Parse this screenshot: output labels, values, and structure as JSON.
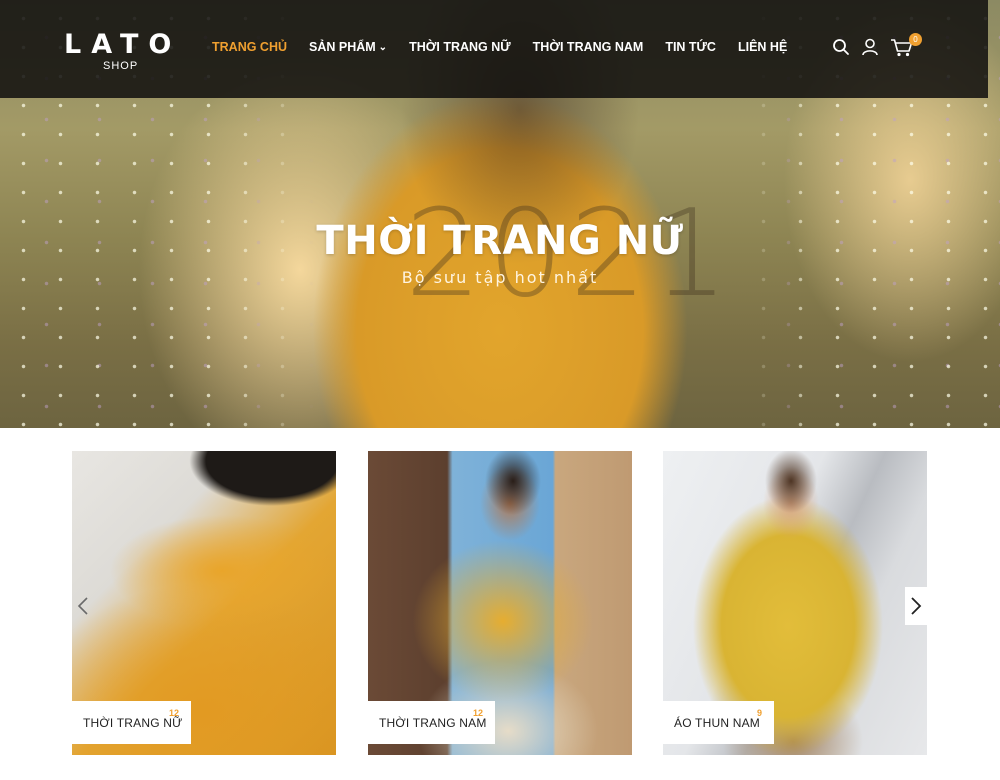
{
  "header": {
    "logo": {
      "main": "LATO",
      "sub": "SHOP"
    },
    "nav": [
      {
        "label": "TRANG CHỦ",
        "active": true
      },
      {
        "label": "SẢN PHẨM",
        "has_dropdown": true
      },
      {
        "label": "THỜI TRANG NỮ"
      },
      {
        "label": "THỜI TRANG NAM"
      },
      {
        "label": "TIN TỨC"
      },
      {
        "label": "LIÊN HỆ"
      }
    ],
    "icons": [
      "search-icon",
      "user-icon",
      "cart-icon"
    ],
    "cart_count": "0"
  },
  "hero": {
    "bg_text": "2021",
    "title": "THỜI TRANG NỮ",
    "subtitle": "Bộ sưu tập hot nhất"
  },
  "categories": [
    {
      "label": "THỜI TRANG NỮ",
      "count": "12"
    },
    {
      "label": "THỜI TRANG NAM",
      "count": "12"
    },
    {
      "label": "ÁO THUN NAM",
      "count": "9"
    }
  ],
  "colors": {
    "accent": "#f0a030",
    "header_bg": "#100f0e",
    "text_dark": "#222222"
  }
}
